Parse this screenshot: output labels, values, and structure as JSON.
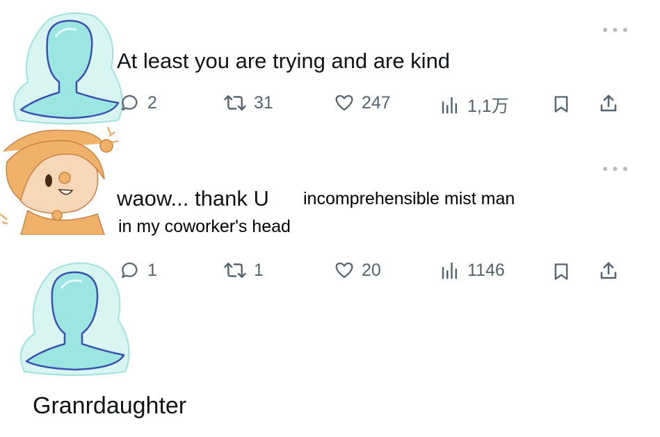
{
  "posts": [
    {
      "text": "At least you are trying and are kind",
      "stats": {
        "replies": "2",
        "reposts": "31",
        "likes": "247",
        "views": "1,1万"
      }
    },
    {
      "text_lead": "waow... thank U",
      "text_pasted_line1": "incomprehensible mist man",
      "text_pasted_line2": "in my coworker's head",
      "stats": {
        "replies": "1",
        "reposts": "1",
        "likes": "20",
        "views": "1146"
      }
    }
  ],
  "final_reply": {
    "text": "Granrdaughter"
  },
  "icons": {
    "reply": "speech-bubble-icon",
    "repost": "repost-arrows-icon",
    "like": "heart-icon",
    "views": "bar-chart-icon",
    "bookmark": "bookmark-icon",
    "share": "share-icon",
    "more": "more-dots-icon"
  },
  "colors": {
    "text": "#0f1419",
    "muted": "#536471",
    "mist": "#8fe0e0",
    "mist_outline": "#3a4fb0",
    "jester": "#f0b26a"
  }
}
